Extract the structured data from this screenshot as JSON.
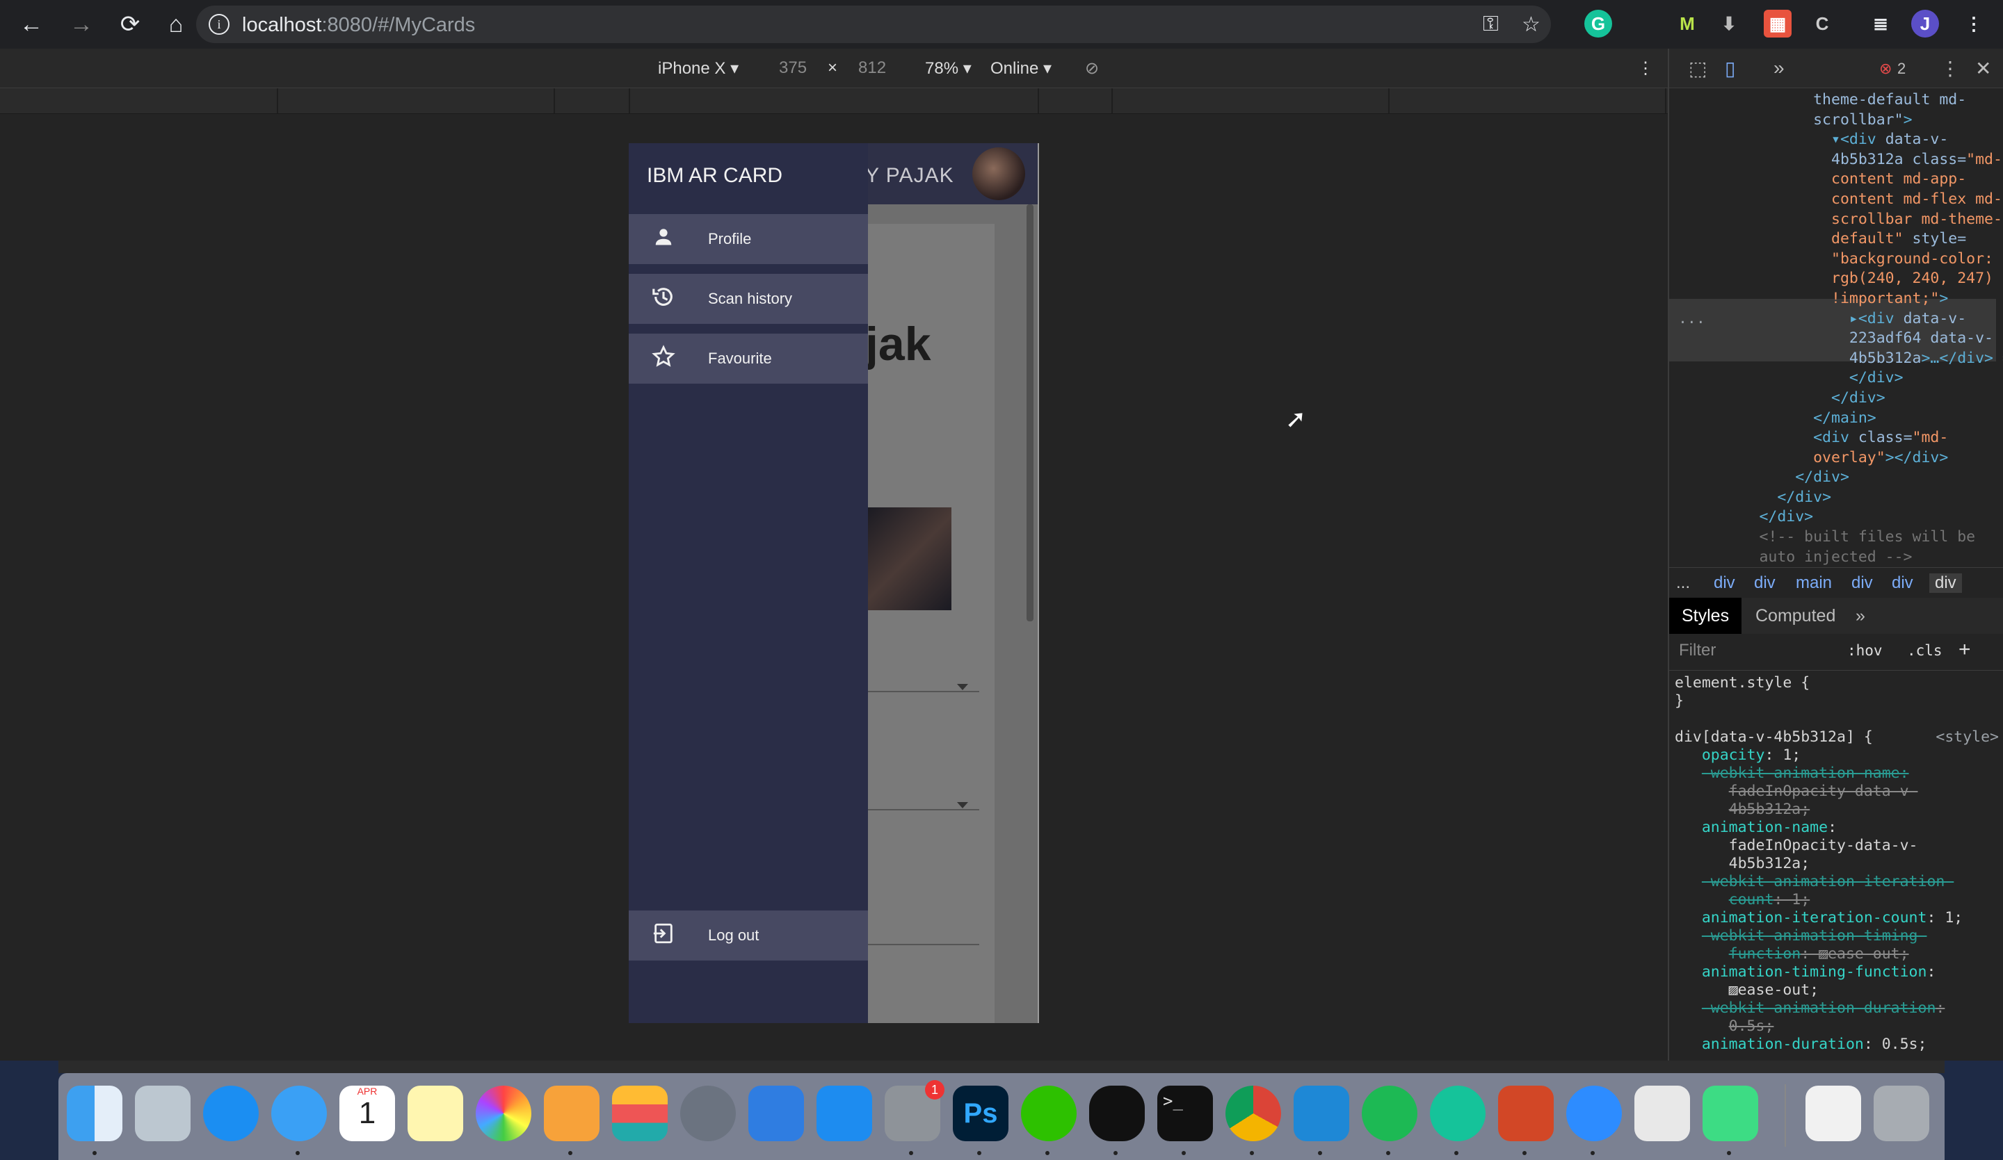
{
  "browser": {
    "url_host": "localhost",
    "url_path": ":8080/#/MyCards",
    "profile_initial": "J"
  },
  "device_toolbar": {
    "device": "iPhone X ▾",
    "width": "375",
    "times": "×",
    "height": "812",
    "zoom": "78% ▾",
    "network": "Online ▾"
  },
  "app": {
    "drawer_title": "IBM AR CARD",
    "appbar_partial": "Y PAJAK",
    "heading_partial": "jak",
    "menu": [
      {
        "label": "Profile",
        "icon": "person-icon"
      },
      {
        "label": "Scan history",
        "icon": "history-icon"
      },
      {
        "label": "Favourite",
        "icon": "star-icon"
      }
    ],
    "logout": {
      "label": "Log out",
      "icon": "logout-icon"
    }
  },
  "devtools": {
    "error_count": "2",
    "breadcrumbs": [
      "...",
      "div",
      "div",
      "main",
      "div",
      "div",
      "div"
    ],
    "tabs": [
      "Styles",
      "Computed"
    ],
    "filter_placeholder": "Filter",
    "hov": ":hov",
    "cls": ".cls",
    "plus": "+",
    "element_style": "element.style {",
    "close_brace": "}",
    "selector": "div[data-v-4b5b312a] {",
    "style_source": "<style>"
  },
  "dock": {
    "calendar_month": "APR",
    "calendar_day": "1",
    "sysprefs_badge": "1"
  }
}
